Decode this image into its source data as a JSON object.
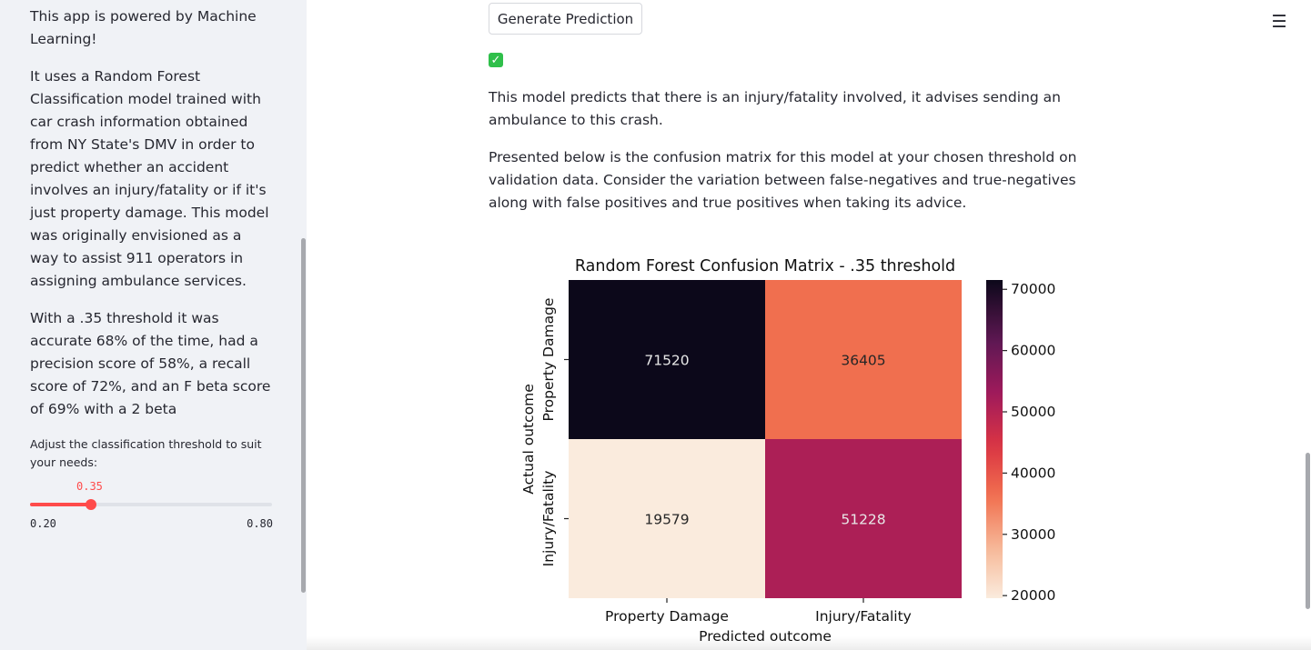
{
  "sidebar": {
    "paragraphs": [
      "This app is powered by Machine Learning!",
      "It uses a Random Forest Classification model trained with car crash information obtained from NY State's DMV in order to predict whether an accident involves an injury/fatality or if it's just property damage. This model was originally envisioned as a way to assist 911 operators in assigning ambulance services.",
      "With a .35 threshold it was accurate 68% of the time, had a precision score of 58%, a recall score of 72%, and an F beta score of 69% with a 2 beta"
    ],
    "slider": {
      "label": "Adjust the classification threshold to suit your needs:",
      "value": "0.35",
      "min": "0.20",
      "max": "0.80",
      "value_fraction": 0.25,
      "accent_color": "#ff4b4b"
    }
  },
  "main": {
    "generate_button_label": "Generate Prediction",
    "success_icon": "check-mark-icon",
    "prediction_text": "This model predicts that there is an injury/fatality involved, it advises sending an ambulance to this crash.",
    "matrix_intro": "Presented below is the confusion matrix for this model at your chosen threshold on validation data. Consider the variation between false-negatives and true-negatives along with false positives and true positives when taking its advice.",
    "menu_icon": "hamburger-menu-icon"
  },
  "chart_data": {
    "type": "heatmap",
    "title": "Random Forest Confusion Matrix - .35 threshold",
    "xlabel": "Predicted outcome",
    "ylabel": "Actual outcome",
    "x_categories": [
      "Property Damage",
      "Injury/Fatality"
    ],
    "y_categories": [
      "Property Damage",
      "Injury/Fatality"
    ],
    "values": [
      [
        71520,
        36405
      ],
      [
        19579,
        51228
      ]
    ],
    "colorbar": {
      "min": 19579,
      "max": 71520,
      "ticks": [
        20000,
        30000,
        40000,
        50000,
        60000,
        70000
      ]
    },
    "colormap": "rocket_r"
  }
}
